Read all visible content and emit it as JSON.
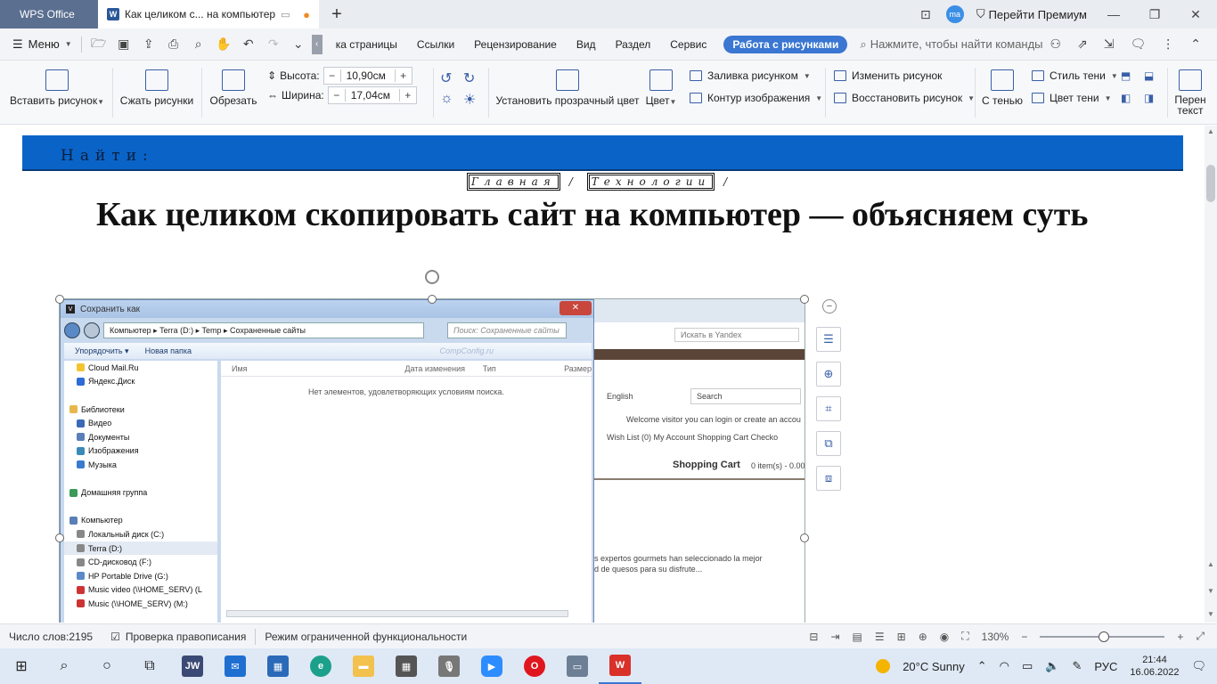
{
  "titlebar": {
    "app_tab": "WPS Office",
    "doc_tab": "Как целиком с... на компьютер",
    "avatar": "ma",
    "premium": "Перейти Премиум"
  },
  "menubar": {
    "menu_label": "Меню",
    "tabs": [
      "ка страницы",
      "Ссылки",
      "Рецензирование",
      "Вид",
      "Раздел",
      "Сервис"
    ],
    "active_tab": "Работа с рисунками",
    "search_placeholder": "Нажмите, чтобы найти команды"
  },
  "ribbon": {
    "insert_picture": "Вставить рисунок",
    "compress": "Сжать рисунки",
    "crop": "Обрезать",
    "height_label": "Высота:",
    "height_value": "10,90см",
    "width_label": "Ширина:",
    "width_value": "17,04см",
    "transparent": "Установить прозрачный цвет",
    "color": "Цвет",
    "fill": "Заливка рисунком",
    "outline": "Контур изображения",
    "change_picture": "Изменить рисунок",
    "restore_picture": "Восстановить рисунок",
    "shadow": "С тенью",
    "shadow_style": "Стиль тени",
    "shadow_color": "Цвет тени",
    "wrap_text": "Перен текст"
  },
  "document": {
    "find_label": "Найти:",
    "breadcrumb_1": "Главная",
    "breadcrumb_sep": "/",
    "breadcrumb_2": "Технологии",
    "headline": "Как целиком скопировать сайт на компьютер — объясняем суть"
  },
  "picture": {
    "dialog_title": "Сохранить как",
    "path": "Компьютер ▸ Terra (D:) ▸ Temp ▸ Сохраненные сайты",
    "search": "Поиск: Сохраненные сайты",
    "organize": "Упорядочить ▾",
    "new_folder": "Новая папка",
    "watermark": "CompConfig.ru",
    "tree": [
      "Cloud Mail.Ru",
      "Яндекс.Диск",
      "",
      "Библиотеки",
      "Видео",
      "Документы",
      "Изображения",
      "Музыка",
      "",
      "Домашняя группа",
      "",
      "Компьютер",
      "Локальный диск (C:)",
      "Terra (D:)",
      "CD-дисковод (F:)",
      "HP Portable Drive (G:)",
      "Music video (\\\\HOME_SERV) (L",
      "Music (\\\\HOME_SERV) (M:)"
    ],
    "columns": [
      "Имя",
      "Дата изменения",
      "Тип",
      "Размер"
    ],
    "empty_message": "Нет элементов, удовлетворяющих условиям поиска.",
    "bg_search": "Искать в Yandex",
    "bg_lang": "English",
    "bg_search2": "Search",
    "bg_welcome": "Welcome visitor you can login or create an accou",
    "bg_links": "Wish List (0)   My Account   Shopping Cart   Checko",
    "bg_cart": "Shopping Cart",
    "bg_cart_items": "0 item(s) - 0.00",
    "bg_spanish_1": "s expertos gourmets han seleccionado la mejor",
    "bg_spanish_2": "d de quesos para su disfrute..."
  },
  "statusbar": {
    "word_count": "Число слов:2195",
    "spellcheck": "Проверка правописания",
    "mode": "Режим ограниченной функциональности",
    "zoom": "130%"
  },
  "taskbar": {
    "weather": "20°C  Sunny",
    "lang": "РУС",
    "time": "21:44",
    "date": "16.06.2022"
  }
}
